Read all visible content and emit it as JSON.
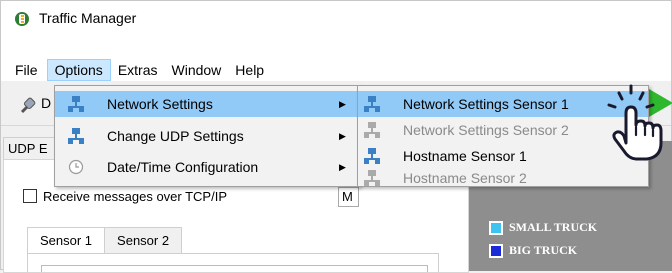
{
  "window": {
    "title": "Traffic Manager"
  },
  "menubar": {
    "items": [
      "File",
      "Options",
      "Extras",
      "Window",
      "Help"
    ],
    "active": "Options"
  },
  "toolbar": {
    "fragment": "D"
  },
  "udp_tab": {
    "label": "UDP E"
  },
  "options_menu": {
    "items": [
      {
        "label": "Network Settings",
        "icon": "network-icon",
        "has_submenu": true,
        "highlighted": true
      },
      {
        "label": "Change UDP Settings",
        "icon": "network-icon",
        "has_submenu": true
      },
      {
        "label": "Date/Time Configuration",
        "icon": "clock-icon",
        "has_submenu": true
      }
    ]
  },
  "network_submenu": {
    "items": [
      {
        "label": "Network Settings Sensor 1",
        "enabled": true,
        "highlighted": true
      },
      {
        "label": "Network Settings Sensor 2",
        "enabled": false
      },
      {
        "label": "Hostname Sensor 1",
        "enabled": true
      },
      {
        "label": "Hostname Sensor 2",
        "enabled": false
      }
    ]
  },
  "content": {
    "tcp_checkbox_label": "Receive messages over TCP/IP",
    "tcp_checked": false,
    "m_fragment": "M",
    "sensor_tabs": [
      "Sensor 1",
      "Sensor 2"
    ],
    "selected_sensor_tab": "Sensor 1"
  },
  "legend": [
    {
      "label": "SMALL TRUCK",
      "color": "#3dc4f0"
    },
    {
      "label": "BIG TRUCK",
      "color": "#1a2ad8"
    }
  ],
  "colors": {
    "play": "#2eb82e",
    "menu_highlight": "#91c9f7",
    "right_panel": "#8e8e8e"
  }
}
